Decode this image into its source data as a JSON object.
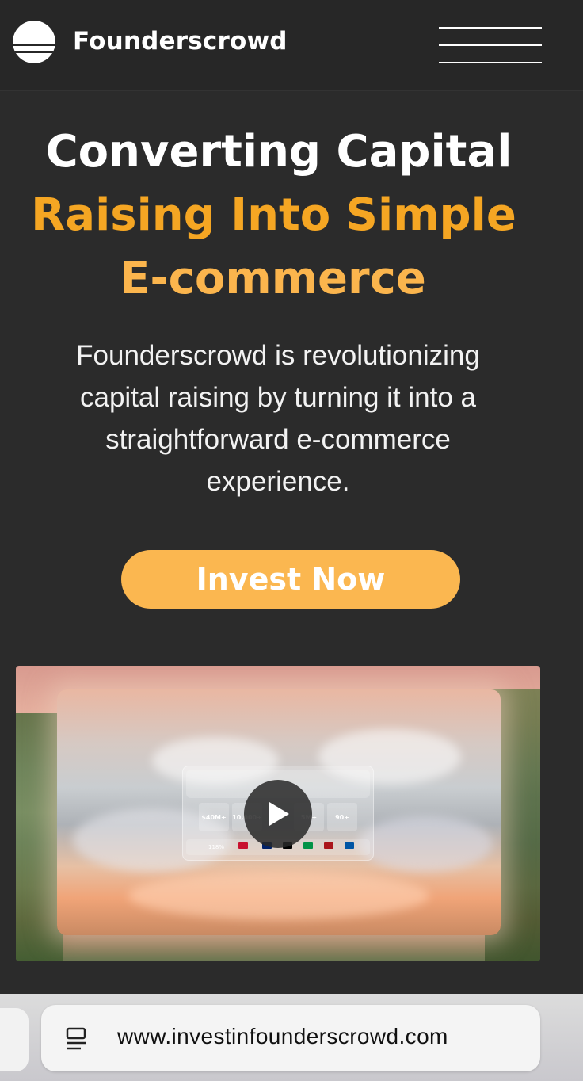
{
  "header": {
    "brand": "Founderscrowd",
    "logo_icon": "founderscrowd-logo-icon",
    "menu_icon": "hamburger-menu-icon"
  },
  "hero": {
    "title_line1": "Converting Capital",
    "title_line2": "Raising Into Simple",
    "title_line3": "E-commerce",
    "description": "Founderscrowd is revolutionizing capital raising by turning it into a straightforward e-commerce experience.",
    "cta_label": "Invest Now"
  },
  "video": {
    "play_icon": "play-icon",
    "stats": [
      {
        "value": "$40M+"
      },
      {
        "value": "10,000+"
      },
      {
        "value": "5M+"
      },
      {
        "value": "90+"
      }
    ],
    "growth_label": "118%"
  },
  "browser": {
    "url": "www.investinfounderscrowd.com",
    "page_icon": "page-info-icon"
  },
  "colors": {
    "background": "#2b2b2b",
    "accent_orange": "#f5a623",
    "accent_light": "#fbb750"
  }
}
